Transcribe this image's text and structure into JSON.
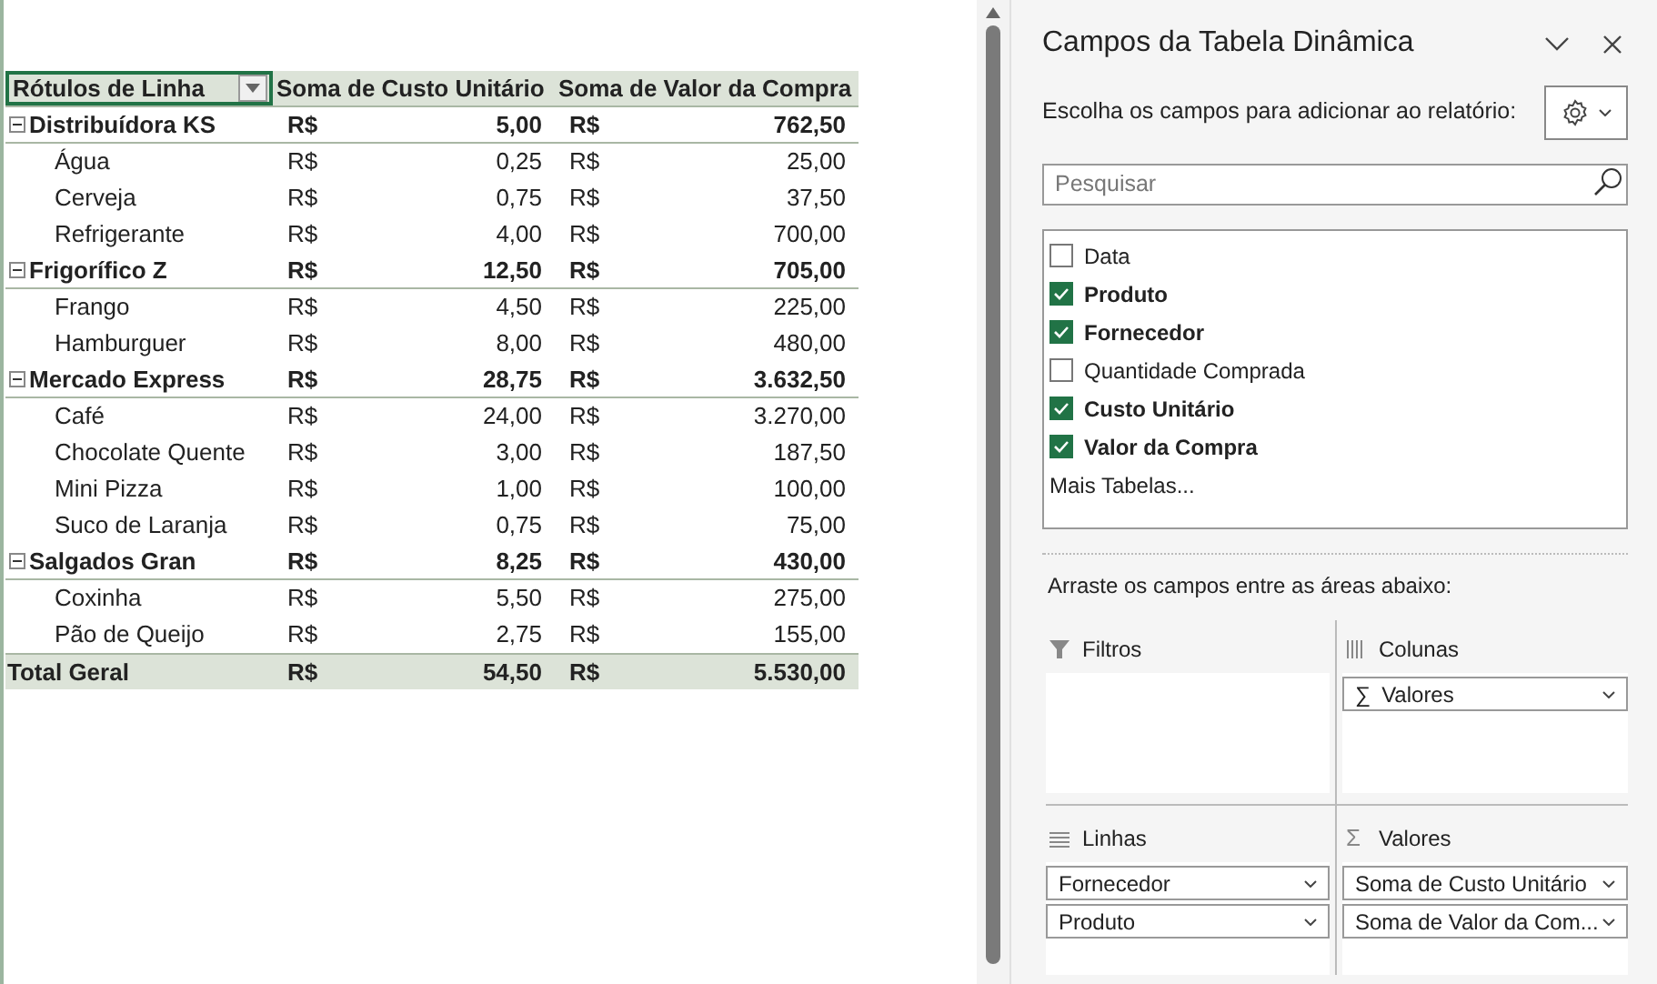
{
  "table": {
    "columns": [
      {
        "label": "Rótulos de Linha",
        "filter_button": true
      },
      {
        "label": "Soma de Custo Unitário",
        "filter_button": false
      },
      {
        "label": "Soma de Valor da Compra",
        "filter_button": false
      }
    ],
    "rows": [
      {
        "kind": "group",
        "expanded": true,
        "label": "Distribuídora KS",
        "cells": [
          "R$",
          "5,00",
          "R$",
          "762,50"
        ]
      },
      {
        "kind": "item",
        "label": "Água",
        "cells": [
          "R$",
          "0,25",
          "R$",
          "25,00"
        ]
      },
      {
        "kind": "item",
        "label": "Cerveja",
        "cells": [
          "R$",
          "0,75",
          "R$",
          "37,50"
        ]
      },
      {
        "kind": "item",
        "label": "Refrigerante",
        "cells": [
          "R$",
          "4,00",
          "R$",
          "700,00"
        ]
      },
      {
        "kind": "group",
        "expanded": true,
        "label": "Frigorífico Z",
        "cells": [
          "R$",
          "12,50",
          "R$",
          "705,00"
        ]
      },
      {
        "kind": "item",
        "label": "Frango",
        "cells": [
          "R$",
          "4,50",
          "R$",
          "225,00"
        ]
      },
      {
        "kind": "item",
        "label": "Hamburguer",
        "cells": [
          "R$",
          "8,00",
          "R$",
          "480,00"
        ]
      },
      {
        "kind": "group",
        "expanded": true,
        "label": "Mercado Express",
        "cells": [
          "R$",
          "28,75",
          "R$",
          "3.632,50"
        ]
      },
      {
        "kind": "item",
        "label": "Café",
        "cells": [
          "R$",
          "24,00",
          "R$",
          "3.270,00"
        ]
      },
      {
        "kind": "item",
        "label": "Chocolate Quente",
        "cells": [
          "R$",
          "3,00",
          "R$",
          "187,50"
        ]
      },
      {
        "kind": "item",
        "label": "Mini Pizza",
        "cells": [
          "R$",
          "1,00",
          "R$",
          "100,00"
        ]
      },
      {
        "kind": "item",
        "label": "Suco de Laranja",
        "cells": [
          "R$",
          "0,75",
          "R$",
          "75,00"
        ]
      },
      {
        "kind": "group",
        "expanded": true,
        "label": "Salgados Gran",
        "cells": [
          "R$",
          "8,25",
          "R$",
          "430,00"
        ]
      },
      {
        "kind": "item",
        "label": "Coxinha",
        "cells": [
          "R$",
          "5,50",
          "R$",
          "275,00"
        ]
      },
      {
        "kind": "item",
        "label": "Pão de Queijo",
        "cells": [
          "R$",
          "2,75",
          "R$",
          "155,00"
        ]
      },
      {
        "kind": "total",
        "label": "Total Geral",
        "cells": [
          "R$",
          "54,50",
          "R$",
          "5.530,00"
        ]
      }
    ]
  },
  "panel": {
    "title": "Campos da Tabela Dinâmica",
    "instruction": "Escolha os campos para adicionar ao relatório:",
    "search": {
      "placeholder": "Pesquisar"
    },
    "fields": [
      {
        "label": "Data",
        "checked": false
      },
      {
        "label": "Produto",
        "checked": true
      },
      {
        "label": "Fornecedor",
        "checked": true
      },
      {
        "label": "Quantidade Comprada",
        "checked": false
      },
      {
        "label": "Custo Unitário",
        "checked": true
      },
      {
        "label": "Valor da Compra",
        "checked": true
      }
    ],
    "more_tables": "Mais Tabelas...",
    "drag_hint": "Arraste os campos entre as áreas abaixo:",
    "areas": [
      {
        "kind": "filters",
        "label": "Filtros"
      },
      {
        "kind": "columns",
        "label": "Colunas",
        "items": [
          {
            "symbol": "∑",
            "label": "Valores"
          }
        ]
      },
      {
        "kind": "rows",
        "label": "Linhas",
        "items": [
          {
            "label": "Fornecedor"
          },
          {
            "label": "Produto"
          }
        ]
      },
      {
        "kind": "values",
        "symbol": "Σ",
        "label": "Valores",
        "items": [
          {
            "label": "Soma de Custo Unitário"
          },
          {
            "label": "Soma de Valor da Com..."
          }
        ]
      }
    ]
  }
}
